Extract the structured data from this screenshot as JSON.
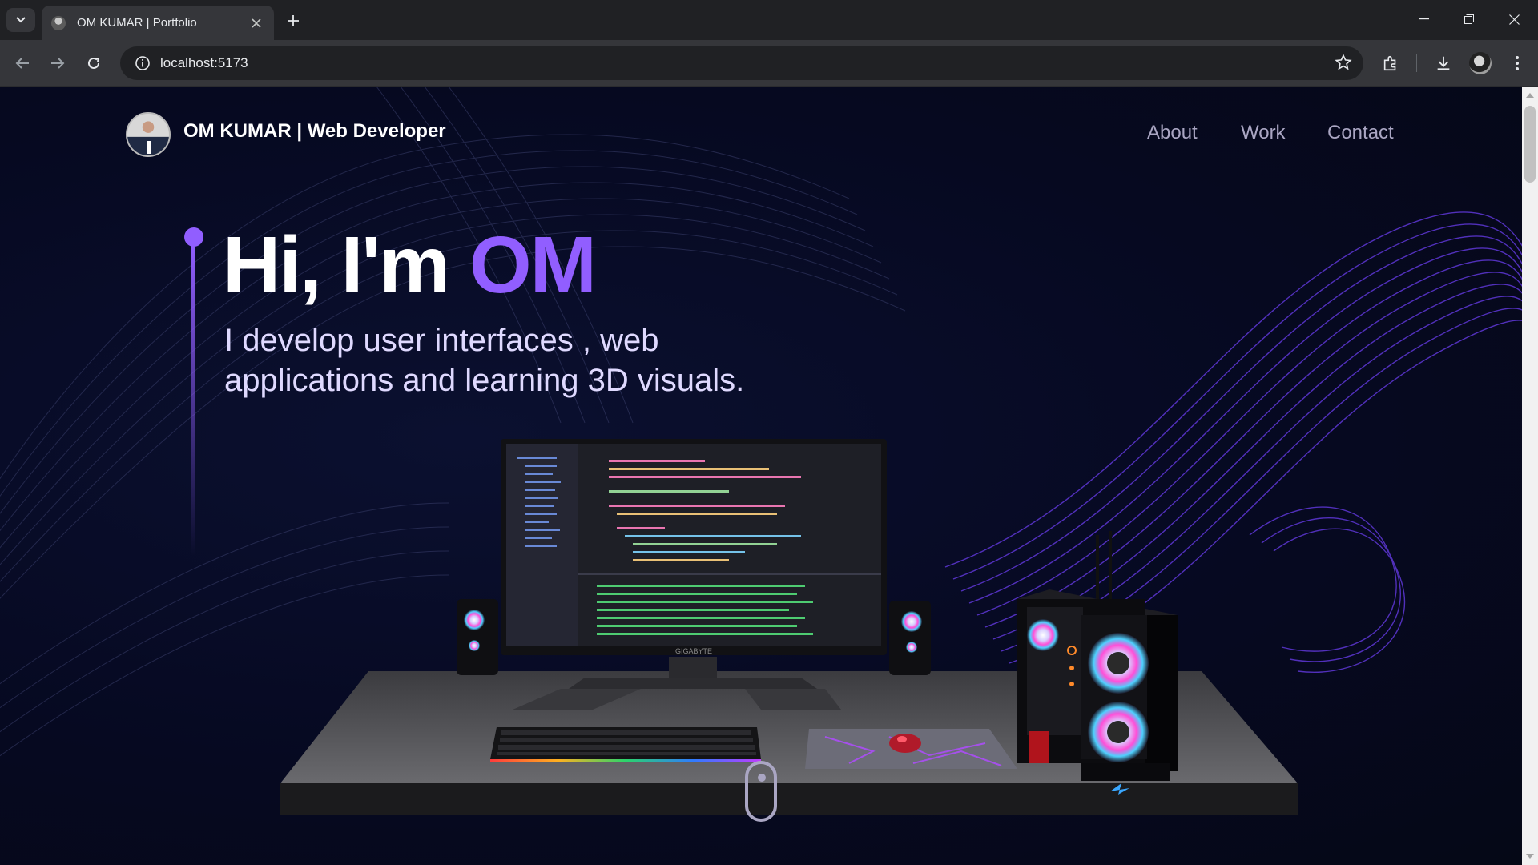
{
  "browser": {
    "tab_title": "OM KUMAR | Portfolio",
    "url": "localhost:5173"
  },
  "site": {
    "brand": "OM KUMAR  | Web Developer",
    "nav": [
      {
        "label": "About"
      },
      {
        "label": "Work"
      },
      {
        "label": "Contact"
      }
    ],
    "hero": {
      "greeting": "Hi, I'm ",
      "name": "OM",
      "subtitle": "I develop user interfaces , web applications and learning 3D visuals."
    },
    "monitor_brand": "GIGABYTE"
  },
  "colors": {
    "accent": "#915eff",
    "background": "#050816",
    "nav_text": "#aaa6c3"
  },
  "icons": [
    "tab-search-icon",
    "close-icon",
    "plus-icon",
    "minimize-icon",
    "restore-icon",
    "back-arrow-icon",
    "forward-arrow-icon",
    "reload-icon",
    "info-icon",
    "star-icon",
    "extensions-icon",
    "download-icon",
    "profile-icon",
    "kebab-menu-icon",
    "scroll-mouse-icon"
  ]
}
